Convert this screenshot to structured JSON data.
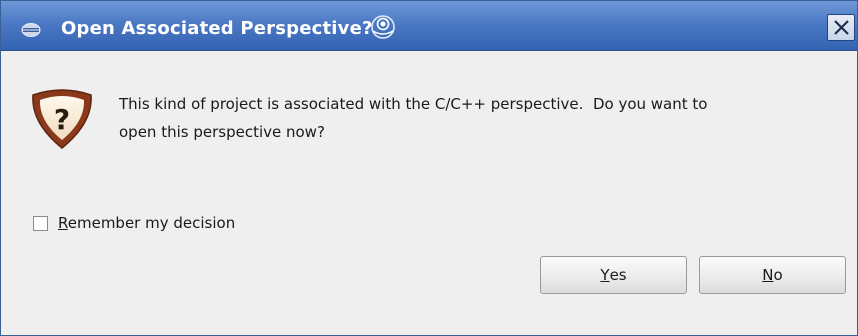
{
  "window": {
    "title": "Open Associated Perspective?"
  },
  "titlebar_icons": {
    "app_icon": "eclipse-icon",
    "sticky_icon": "sticky-icon",
    "close_icon": "close-icon",
    "close_glyph": "×"
  },
  "dialog": {
    "icon": "question-icon",
    "icon_glyph": "?",
    "message_line1": "This kind of project is associated with the C/C++ perspective.  Do you want to",
    "message_line2": "open this perspective now?"
  },
  "remember": {
    "mnemonic": "R",
    "label_rest": "emember my decision",
    "checked": false
  },
  "buttons": {
    "yes_mnemonic": "Y",
    "yes_rest": "es",
    "no_mnemonic": "N",
    "no_rest": "o"
  },
  "colors": {
    "titlebar": "#4b79c4",
    "dialog_bg": "#efefef",
    "question_icon_ring": "#8a3a1a"
  }
}
